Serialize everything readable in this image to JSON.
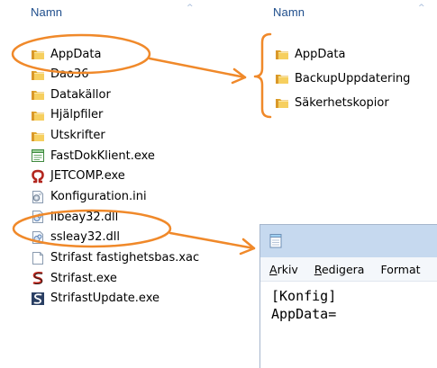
{
  "left_panel": {
    "header": "Namn",
    "items": [
      {
        "label": "AppData",
        "icon": "folder-icon"
      },
      {
        "label": "Dao36",
        "icon": "folder-icon"
      },
      {
        "label": "Datakällor",
        "icon": "folder-icon"
      },
      {
        "label": "Hjälpfiler",
        "icon": "folder-icon"
      },
      {
        "label": "Utskrifter",
        "icon": "folder-icon"
      },
      {
        "label": "FastDokKlient.exe",
        "icon": "window-exe-icon"
      },
      {
        "label": "JETCOMP.exe",
        "icon": "omega-exe-icon"
      },
      {
        "label": "Konfiguration.ini",
        "icon": "ini-settings-icon"
      },
      {
        "label": "libeay32.dll",
        "icon": "dll-icon"
      },
      {
        "label": "ssleay32.dll",
        "icon": "dll-icon"
      },
      {
        "label": "Strifast fastighetsbas.xac",
        "icon": "blank-file-icon"
      },
      {
        "label": "Strifast.exe",
        "icon": "strifast-exe-icon"
      },
      {
        "label": "StrifastUpdate.exe",
        "icon": "strifast-update-icon"
      }
    ]
  },
  "right_panel": {
    "header": "Namn",
    "items": [
      {
        "label": "AppData",
        "icon": "folder-icon"
      },
      {
        "label": "BackupUppdatering",
        "icon": "folder-icon"
      },
      {
        "label": "Säkerhetskopior",
        "icon": "folder-icon"
      }
    ]
  },
  "notepad": {
    "menu": [
      {
        "accel": "A",
        "rest": "rkiv"
      },
      {
        "accel": "R",
        "rest": "edigera"
      },
      {
        "accel": "",
        "rest": "Format"
      }
    ],
    "content_lines": [
      "[Konfig]",
      "AppData="
    ]
  },
  "annotation": {
    "color": "#f0892a"
  }
}
